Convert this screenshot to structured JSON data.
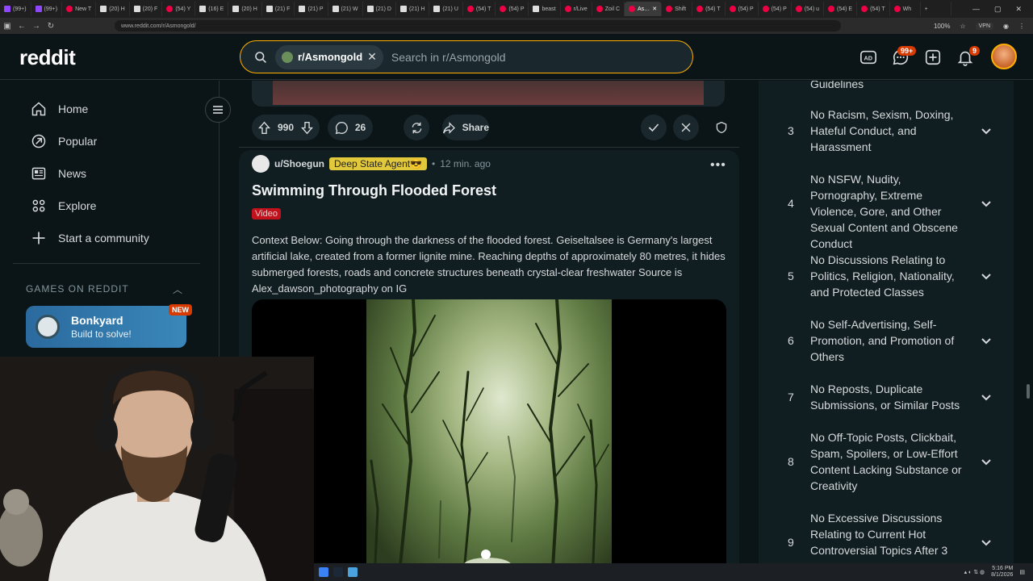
{
  "browser": {
    "tabs": [
      "(99+)",
      "(99+)",
      "New T",
      "(20) H",
      "(20) F",
      "(54) Y",
      "(16) E",
      "(20) H",
      "(21) F",
      "(21) P",
      "(21) W",
      "(21) D",
      "(21) H",
      "(21) U",
      "(54) T",
      "(54) P",
      "beast",
      "r/Live",
      "Zoil C",
      "As…",
      "Shift",
      "(54) T",
      "(54) P",
      "(54) P",
      "(54) u",
      "(54) E",
      "(54) T",
      "Wh"
    ],
    "url": "www.reddit.com/r/Asmongold/",
    "zoom": "100%",
    "vpn_label": "VPN"
  },
  "header": {
    "logo": "reddit",
    "search_chip": "r/Asmongold",
    "search_placeholder": "Search in r/Asmongold",
    "chat_badge": "99+",
    "notif_badge": "9"
  },
  "sidebar": {
    "items": [
      {
        "label": "Home",
        "icon": "home-icon"
      },
      {
        "label": "Popular",
        "icon": "popular-icon"
      },
      {
        "label": "News",
        "icon": "news-icon"
      },
      {
        "label": "Explore",
        "icon": "explore-icon"
      },
      {
        "label": "Start a community",
        "icon": "plus-icon"
      }
    ],
    "games_label": "GAMES ON REDDIT",
    "game": {
      "name": "Bonkyard",
      "sub": "Build to solve!",
      "badge": "NEW"
    }
  },
  "prev_post": {
    "votes": "990",
    "comments": "26",
    "share": "Share"
  },
  "post": {
    "user": "u/Shoegun",
    "flair": "Deep State Agent😎",
    "time": "12 min. ago",
    "title": "Swimming Through Flooded Forest",
    "post_flair": "Video",
    "body": "Context Below: Going through the darkness of the flooded forest. Geiseltalsee is Germany's largest artificial lake, created from a former lignite mine. Reaching depths of approximately 80 metres, it hides submerged forests, roads and concrete structures beneath crystal-clear freshwater Source is Alex_dawson_photography on IG"
  },
  "rules": {
    "partial_top": "Guidelines",
    "items": [
      {
        "num": "3",
        "text": "No Racism, Sexism, Doxing, Hateful Conduct, and Harassment"
      },
      {
        "num": "4",
        "text": "No NSFW, Nudity, Pornography, Extreme Violence, Gore, and Other Sexual Content and Obscene Conduct"
      },
      {
        "num": "5",
        "text": "No Discussions Relating to Politics, Religion, Nationality, and Protected Classes"
      },
      {
        "num": "6",
        "text": "No Self-Advertising, Self-Promotion, and Promotion of Others"
      },
      {
        "num": "7",
        "text": "No Reposts, Duplicate Submissions, or Similar Posts"
      },
      {
        "num": "8",
        "text": "No Off-Topic Posts, Clickbait, Spam, Spoilers, or Low-Effort Content Lacking Substance or Creativity"
      },
      {
        "num": "9",
        "text": "No Excessive Discussions Relating to Current Hot Controversial Topics After 3"
      }
    ]
  },
  "taskbar": {
    "time": "5:16 PM",
    "date": "8/1/2026"
  },
  "colors": {
    "bg": "#0b1416",
    "accent": "#ffb000",
    "orange": "#d93a00",
    "flair": "#e2c93c",
    "video_flair": "#c1111c"
  }
}
